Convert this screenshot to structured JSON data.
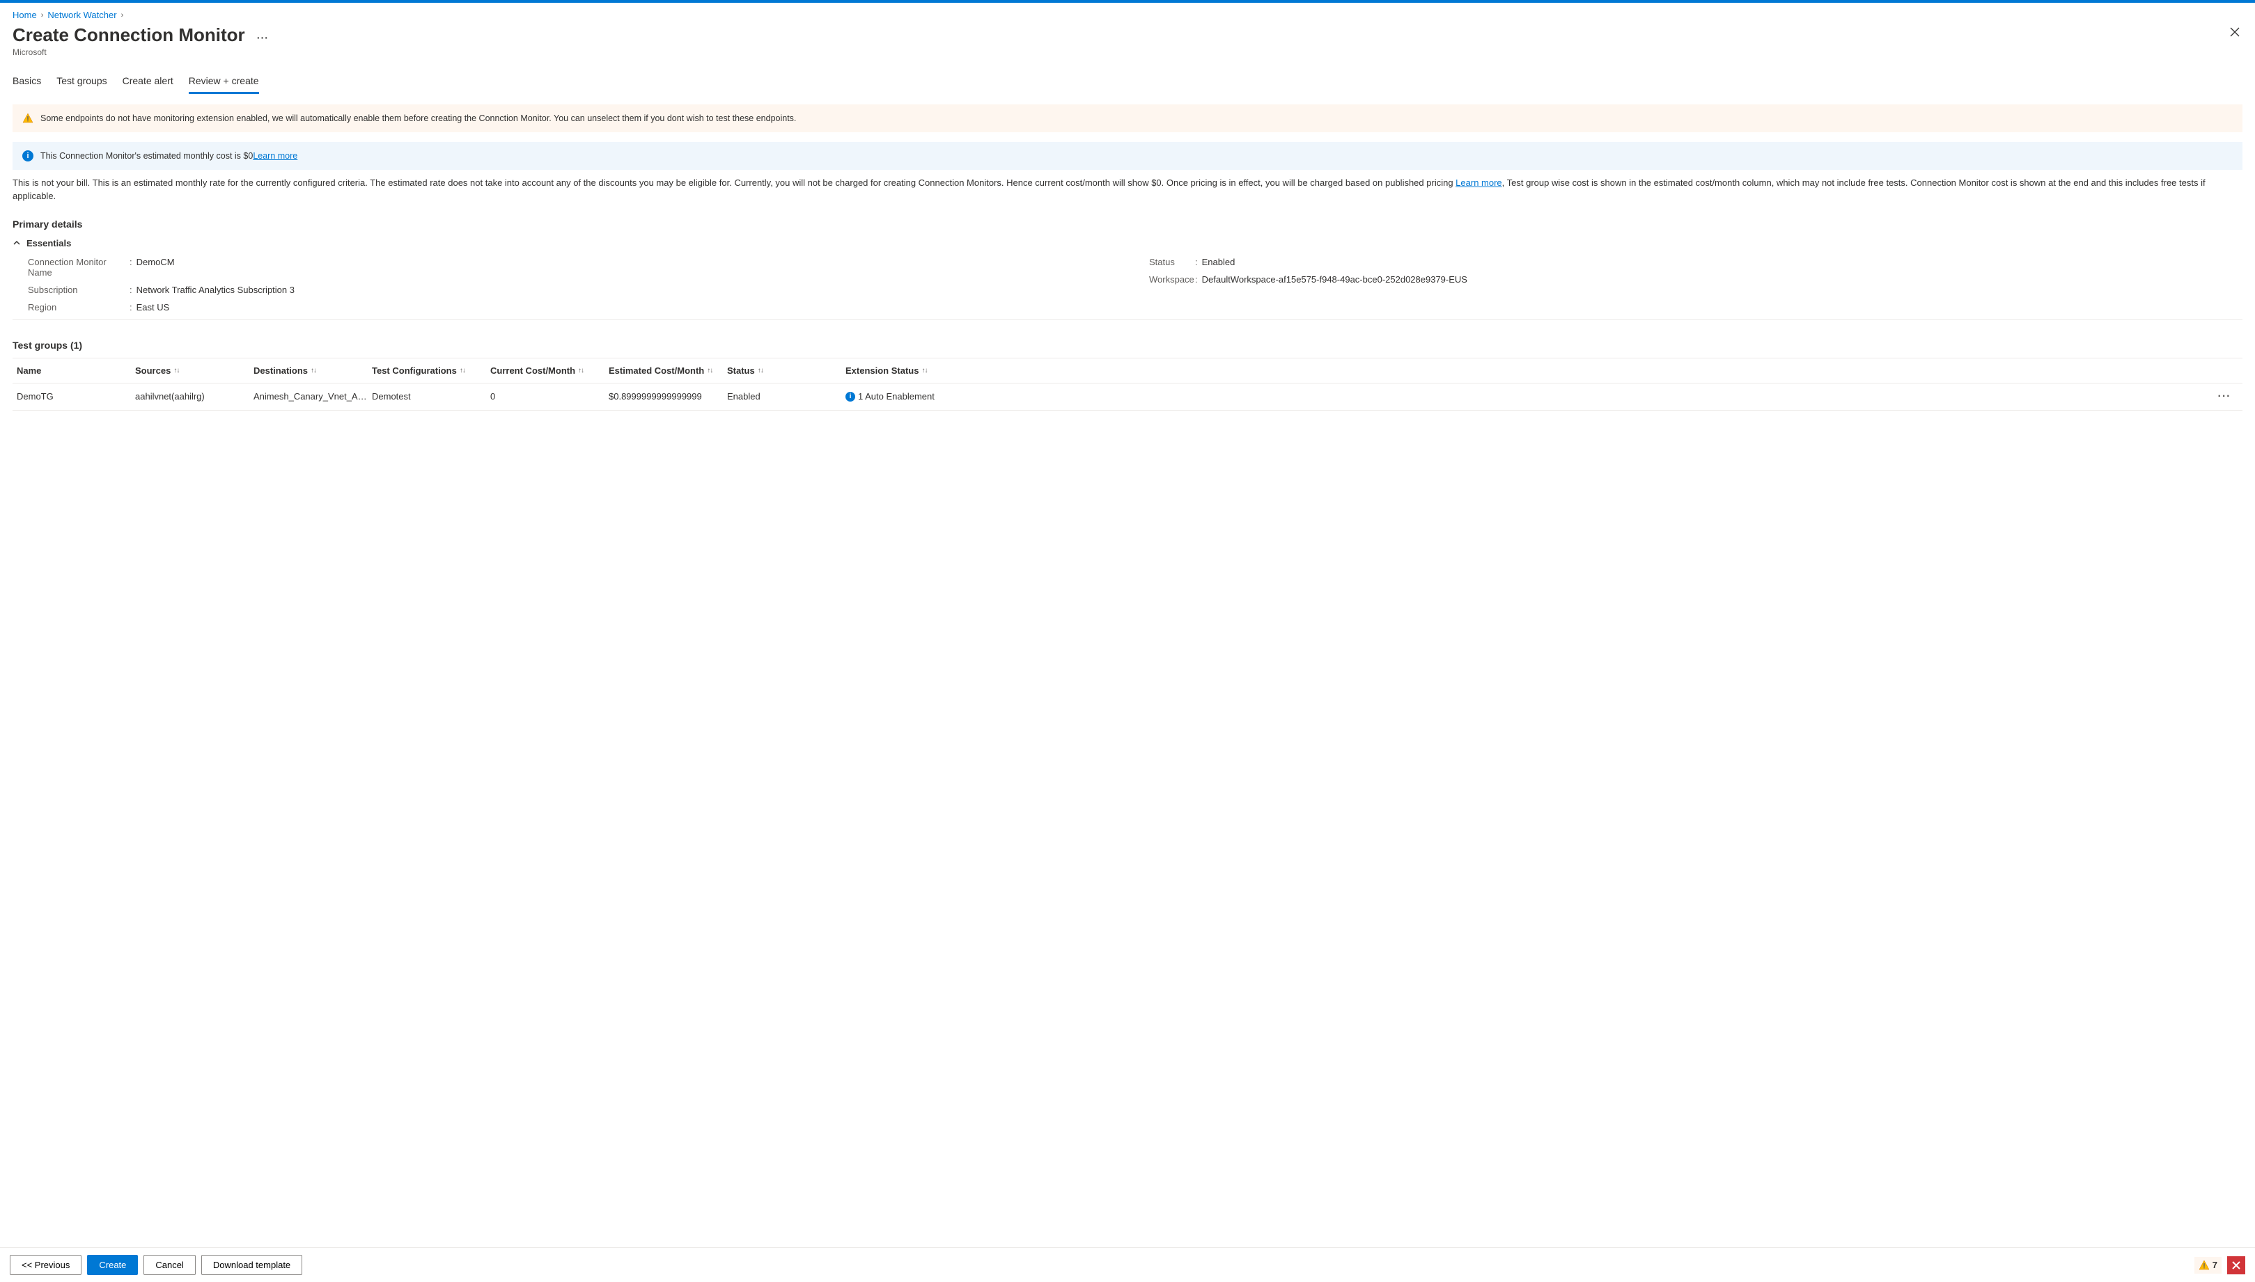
{
  "breadcrumb": {
    "home": "Home",
    "watcher": "Network Watcher"
  },
  "header": {
    "title": "Create Connection Monitor",
    "subtitle": "Microsoft",
    "more": "···"
  },
  "tabs": [
    "Basics",
    "Test groups",
    "Create alert",
    "Review + create"
  ],
  "alerts": {
    "warn": "Some endpoints do not have monitoring extension enabled, we will automatically enable them before creating the Connction Monitor. You can unselect them if you dont wish to test these endpoints.",
    "info_prefix": "This Connection Monitor's estimated monthly cost is $0",
    "info_link": "Learn more"
  },
  "billing_paragraph": {
    "before": "This is not your bill. This is an estimated monthly rate for the currently configured criteria. The estimated rate does not take into account any of the discounts you may be eligible for. Currently, you will not be charged for creating Connection Monitors. Hence current cost/month will show $0. Once pricing is in effect, you will be charged based on published pricing ",
    "link": "Learn more",
    "after": ", Test group wise cost is shown in the estimated cost/month column, which may not include free tests. Connection Monitor cost is shown at the end and this includes free tests if applicable."
  },
  "primary_details_title": "Primary details",
  "essentials_label": "Essentials",
  "essentials": {
    "left": [
      {
        "label": "Connection Monitor Name",
        "value": "DemoCM"
      },
      {
        "label": "Subscription",
        "value": "Network Traffic Analytics Subscription 3"
      },
      {
        "label": "Region",
        "value": "East US"
      }
    ],
    "right": [
      {
        "label": "Status",
        "value": "Enabled"
      },
      {
        "label": "Workspace",
        "value": "DefaultWorkspace-af15e575-f948-49ac-bce0-252d028e9379-EUS"
      }
    ]
  },
  "test_groups": {
    "title": "Test groups (1)",
    "columns": [
      "Name",
      "Sources",
      "Destinations",
      "Test Configurations",
      "Current Cost/Month",
      "Estimated Cost/Month",
      "Status",
      "Extension Status"
    ],
    "rows": [
      {
        "name": "DemoTG",
        "sources": "aahilvnet(aahilrg)",
        "destinations": "Animesh_Canary_Vnet_ANM(…",
        "test_configs": "Demotest",
        "current_cost": "0",
        "estimated_cost": "$0.8999999999999999",
        "status": "Enabled",
        "extension_status": "1 Auto Enablement"
      }
    ]
  },
  "footer": {
    "previous": "<< Previous",
    "create": "Create",
    "cancel": "Cancel",
    "download": "Download template",
    "warn_count": "7"
  }
}
